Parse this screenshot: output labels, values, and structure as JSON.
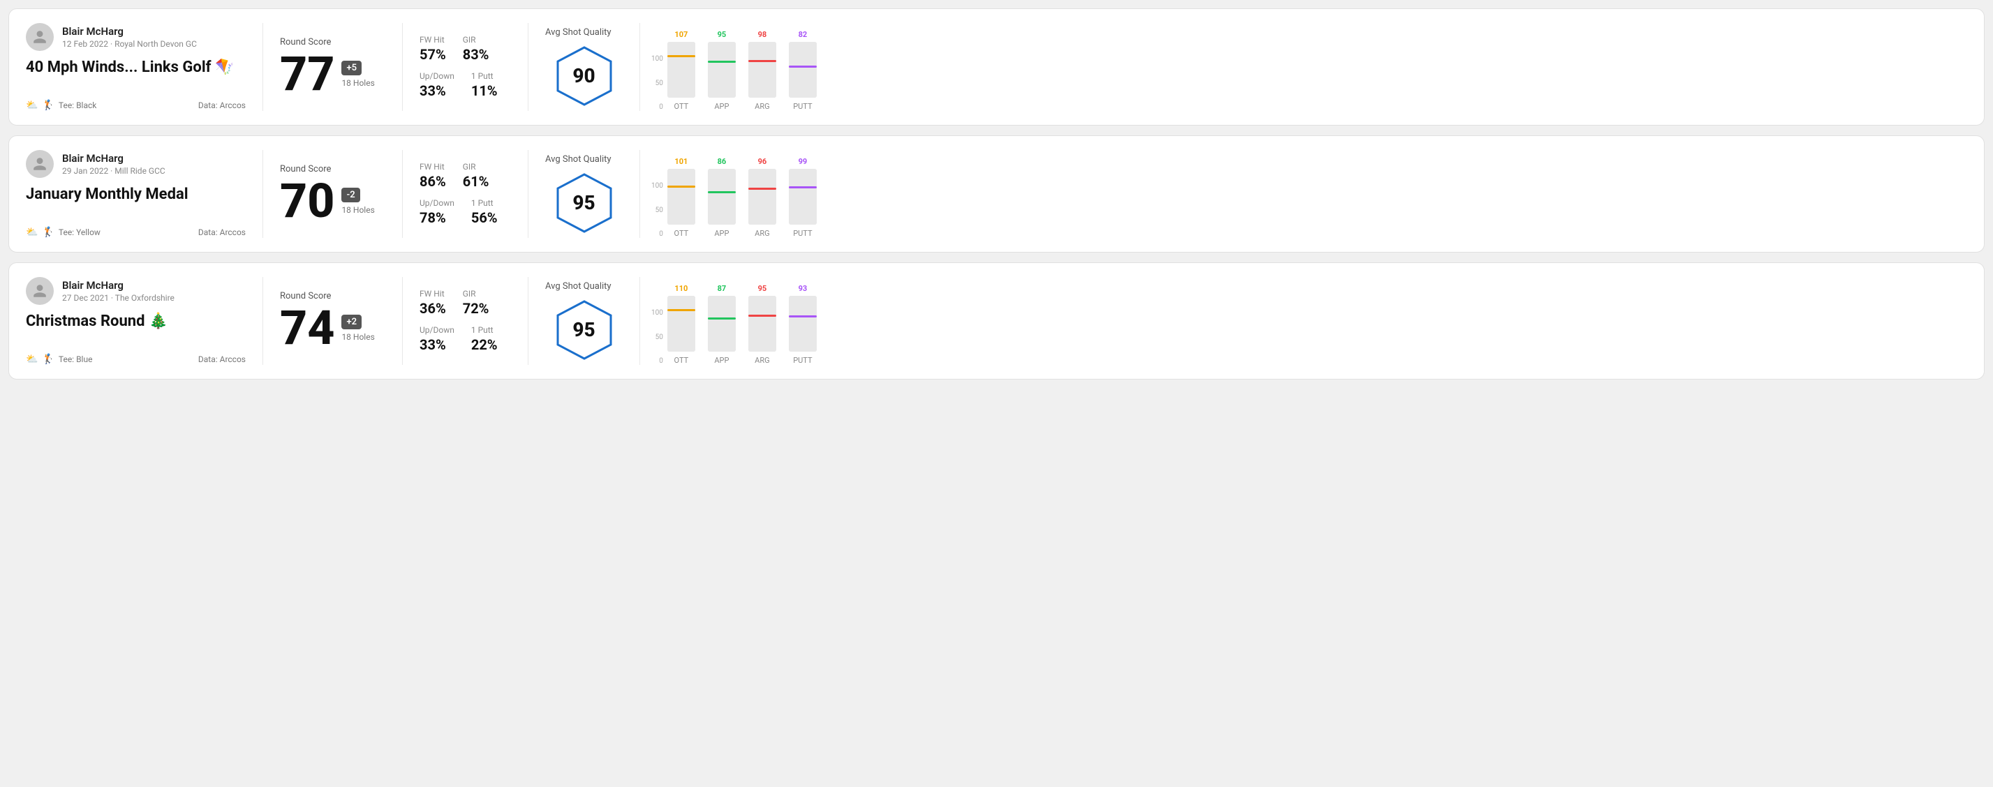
{
  "rounds": [
    {
      "id": "round1",
      "user": {
        "name": "Blair McHarg",
        "meta": "12 Feb 2022 · Royal North Devon GC"
      },
      "title": "40 Mph Winds... Links Golf 🪁",
      "tee": "Black",
      "data_source": "Arccos",
      "score": {
        "value": "77",
        "modifier": "+5",
        "holes": "18 Holes"
      },
      "stats": {
        "fw_hit_label": "FW Hit",
        "fw_hit_value": "57%",
        "gir_label": "GIR",
        "gir_value": "83%",
        "updown_label": "Up/Down",
        "updown_value": "33%",
        "one_putt_label": "1 Putt",
        "one_putt_value": "11%"
      },
      "quality": {
        "label": "Avg Shot Quality",
        "value": "90"
      },
      "chart": {
        "y_labels": [
          "100",
          "50",
          "0"
        ],
        "columns": [
          {
            "label": "OTT",
            "value": 107,
            "color_class": "bar-ott",
            "value_color": "color-ott",
            "fill_pct": 72
          },
          {
            "label": "APP",
            "value": 95,
            "color_class": "bar-app",
            "value_color": "color-app",
            "fill_pct": 62
          },
          {
            "label": "ARG",
            "value": 98,
            "color_class": "bar-arg",
            "value_color": "color-arg",
            "fill_pct": 64
          },
          {
            "label": "PUTT",
            "value": 82,
            "color_class": "bar-putt",
            "value_color": "color-putt",
            "fill_pct": 54
          }
        ]
      }
    },
    {
      "id": "round2",
      "user": {
        "name": "Blair McHarg",
        "meta": "29 Jan 2022 · Mill Ride GCC"
      },
      "title": "January Monthly Medal",
      "tee": "Yellow",
      "data_source": "Arccos",
      "score": {
        "value": "70",
        "modifier": "-2",
        "holes": "18 Holes"
      },
      "stats": {
        "fw_hit_label": "FW Hit",
        "fw_hit_value": "86%",
        "gir_label": "GIR",
        "gir_value": "61%",
        "updown_label": "Up/Down",
        "updown_value": "78%",
        "one_putt_label": "1 Putt",
        "one_putt_value": "56%"
      },
      "quality": {
        "label": "Avg Shot Quality",
        "value": "95"
      },
      "chart": {
        "y_labels": [
          "100",
          "50",
          "0"
        ],
        "columns": [
          {
            "label": "OTT",
            "value": 101,
            "color_class": "bar-ott",
            "value_color": "color-ott",
            "fill_pct": 66
          },
          {
            "label": "APP",
            "value": 86,
            "color_class": "bar-app",
            "value_color": "color-app",
            "fill_pct": 56
          },
          {
            "label": "ARG",
            "value": 96,
            "color_class": "bar-arg",
            "value_color": "color-arg",
            "fill_pct": 63
          },
          {
            "label": "PUTT",
            "value": 99,
            "color_class": "bar-putt",
            "value_color": "color-putt",
            "fill_pct": 65
          }
        ]
      }
    },
    {
      "id": "round3",
      "user": {
        "name": "Blair McHarg",
        "meta": "27 Dec 2021 · The Oxfordshire"
      },
      "title": "Christmas Round 🎄",
      "tee": "Blue",
      "data_source": "Arccos",
      "score": {
        "value": "74",
        "modifier": "+2",
        "holes": "18 Holes"
      },
      "stats": {
        "fw_hit_label": "FW Hit",
        "fw_hit_value": "36%",
        "gir_label": "GIR",
        "gir_value": "72%",
        "updown_label": "Up/Down",
        "updown_value": "33%",
        "one_putt_label": "1 Putt",
        "one_putt_value": "22%"
      },
      "quality": {
        "label": "Avg Shot Quality",
        "value": "95"
      },
      "chart": {
        "y_labels": [
          "100",
          "50",
          "0"
        ],
        "columns": [
          {
            "label": "OTT",
            "value": 110,
            "color_class": "bar-ott",
            "value_color": "color-ott",
            "fill_pct": 72
          },
          {
            "label": "APP",
            "value": 87,
            "color_class": "bar-app",
            "value_color": "color-app",
            "fill_pct": 57
          },
          {
            "label": "ARG",
            "value": 95,
            "color_class": "bar-arg",
            "value_color": "color-arg",
            "fill_pct": 62
          },
          {
            "label": "PUTT",
            "value": 93,
            "color_class": "bar-putt",
            "value_color": "color-putt",
            "fill_pct": 61
          }
        ]
      }
    }
  ],
  "labels": {
    "round_score": "Round Score",
    "holes_18": "18 Holes",
    "tee_prefix": "Tee:",
    "data_prefix": "Data:"
  }
}
